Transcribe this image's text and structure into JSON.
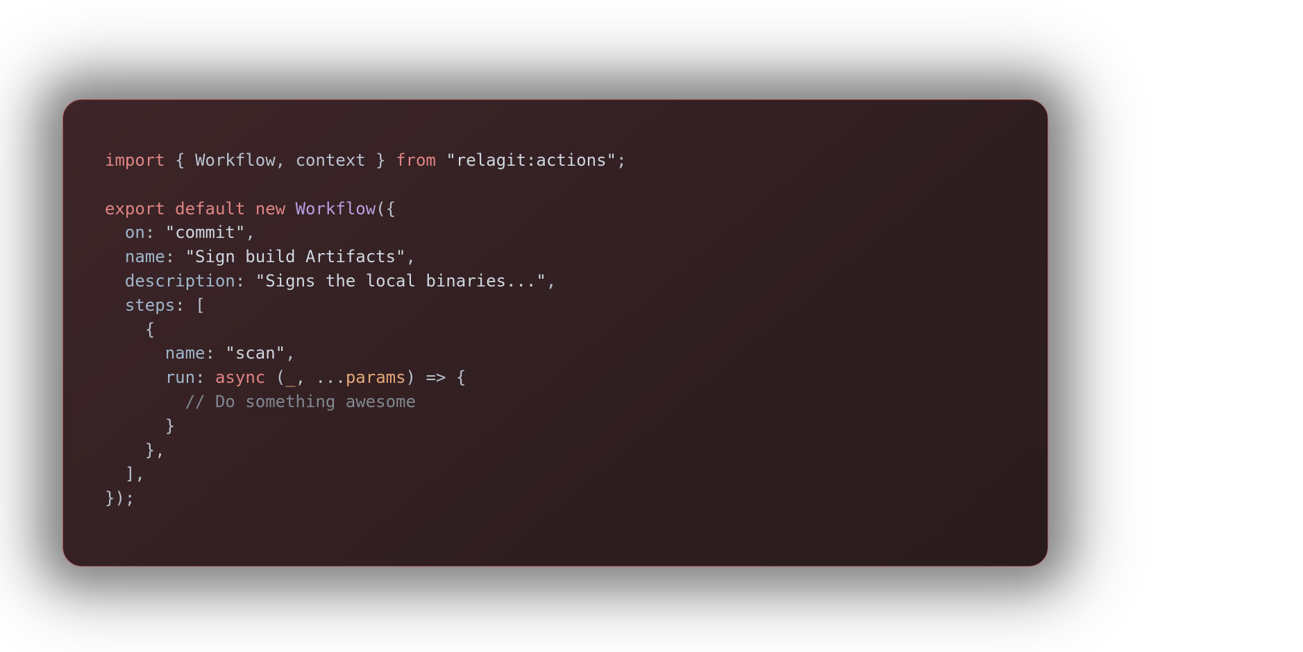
{
  "code": {
    "t_import": "import",
    "t_brace_open_sp": " { ",
    "t_workflow_ident": "Workflow",
    "t_comma_sp": ", ",
    "t_context_ident": "context",
    "t_sp_brace_close_sp": " } ",
    "t_from": "from",
    "t_sp": " ",
    "t_module_str": "\"relagit:actions\"",
    "t_semi": ";",
    "t_export": "export",
    "t_default": "default",
    "t_new": "new",
    "t_workflow_cls": "Workflow",
    "t_paren_brace_open": "({",
    "t_indent1": "  ",
    "t_key_on": "on",
    "t_colon_sp": ": ",
    "t_val_on": "\"commit\"",
    "t_comma": ",",
    "t_key_name": "name",
    "t_val_name": "\"Sign build Artifacts\"",
    "t_key_description": "description",
    "t_val_description": "\"Signs the local binaries...\"",
    "t_key_steps": "steps",
    "t_bracket_open": "[",
    "t_indent2": "    ",
    "t_brace_open": "{",
    "t_indent3": "      ",
    "t_step_key_name": "name",
    "t_step_val_name": "\"scan\"",
    "t_step_key_run": "run",
    "t_async": "async",
    "t_paren_open": " (",
    "t_underscore": "_",
    "t_spread": "...",
    "t_params_ident": "params",
    "t_paren_close_arrow_brace": ") => {",
    "t_indent4": "        ",
    "t_comment": "// Do something awesome",
    "t_brace_close": "}",
    "t_bracket_close": "]",
    "t_close_all": "});"
  }
}
